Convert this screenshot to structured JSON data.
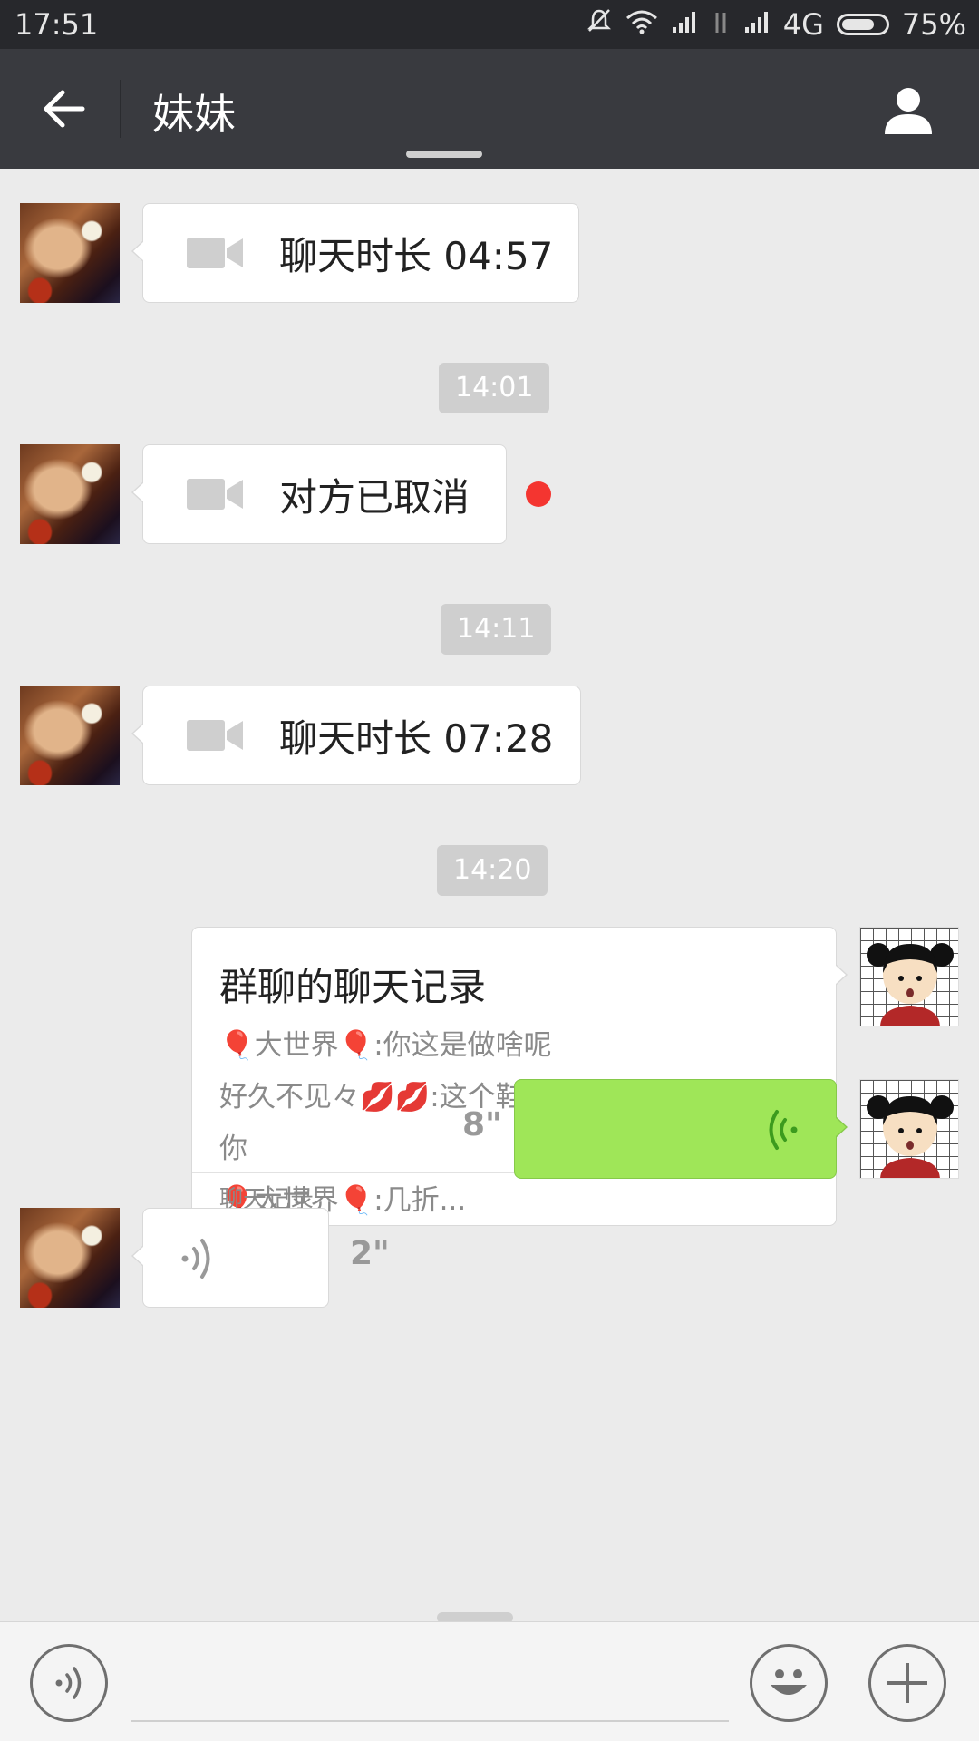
{
  "status_bar": {
    "time": "17:51",
    "network": "4G",
    "battery": "75%",
    "battery_level": 0.75
  },
  "header": {
    "title": "妹妹"
  },
  "messages": {
    "call1": {
      "text": "聊天时长 04:57"
    },
    "ts1": "14:01",
    "call2": {
      "text": "对方已取消"
    },
    "ts2": "14:11",
    "call3": {
      "text": "聊天时长 07:28"
    },
    "ts3": "14:20",
    "chat_record": {
      "title": "群聊的聊天记录",
      "line1": "🎈大世界🎈:你这是做啥呢",
      "line2": "好久不见々💋💋:这个鞋打折呢这不是问问",
      "line3": "你",
      "line4": "🎈大世界🎈:几折...",
      "footer": "聊天记录"
    },
    "voice_out": {
      "duration": "8\""
    },
    "voice_in": {
      "duration": "2\""
    }
  },
  "colors": {
    "header_bg": "#393a3f",
    "status_bg": "#27282c",
    "chat_bg": "#ebebeb",
    "voice_green": "#9fe658",
    "unread_red": "#f43530"
  }
}
